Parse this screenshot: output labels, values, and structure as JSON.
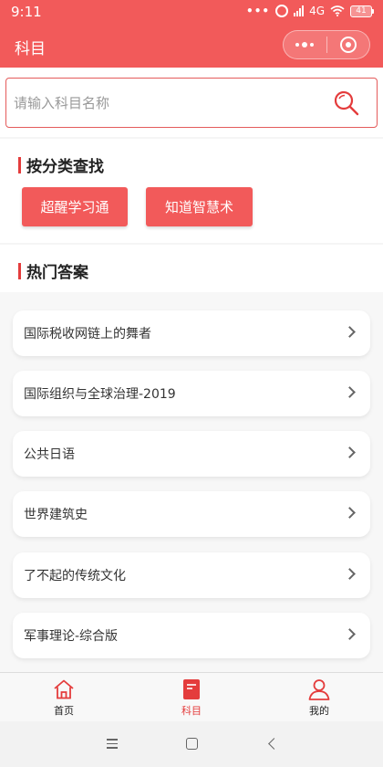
{
  "status_bar": {
    "time": "9:11",
    "dots": "•••",
    "network": "4G",
    "battery": "41"
  },
  "nav": {
    "title": "科目"
  },
  "search": {
    "placeholder": "请输入科目名称"
  },
  "category": {
    "title": "按分类查找",
    "buttons": [
      "超醒学习通",
      "知道智慧术"
    ]
  },
  "hot": {
    "title": "热门答案",
    "items": [
      "国际税收网链上的舞者",
      "国际组织与全球治理-2019",
      "公共日语",
      "世界建筑史",
      "了不起的传统文化",
      "军事理论-综合版"
    ]
  },
  "tabbar": {
    "tabs": [
      {
        "label": "首页",
        "icon": "home-icon"
      },
      {
        "label": "科目",
        "icon": "book-icon",
        "active": true
      },
      {
        "label": "我的",
        "icon": "person-icon"
      }
    ]
  },
  "colors": {
    "primary": "#f25a5a",
    "accent": "#e43c3c"
  }
}
